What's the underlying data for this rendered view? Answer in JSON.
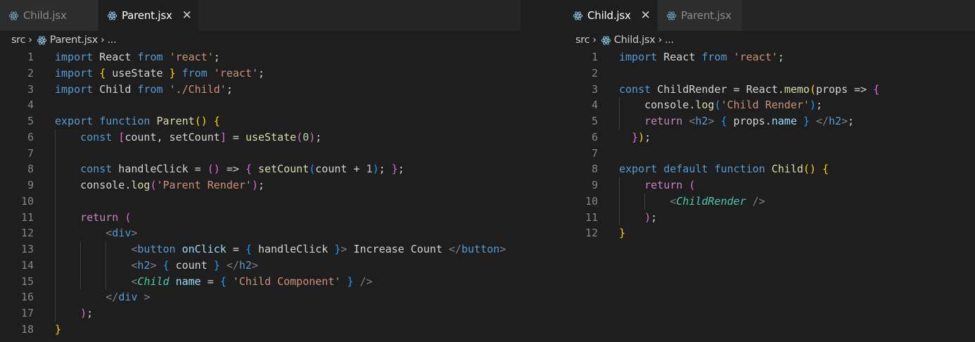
{
  "left": {
    "tabs": [
      {
        "label": "Child.jsx",
        "active": false
      },
      {
        "label": "Parent.jsx",
        "active": true,
        "close": "✕"
      }
    ],
    "breadcrumb": {
      "root": "src",
      "file": "Parent.jsx",
      "tail": "..."
    },
    "lines": [
      [
        [
          "kw",
          "import"
        ],
        [
          "plain",
          " React "
        ],
        [
          "kw",
          "from"
        ],
        [
          "plain",
          " "
        ],
        [
          "str",
          "'react'"
        ],
        [
          "plain",
          ";"
        ]
      ],
      [
        [
          "kw",
          "import"
        ],
        [
          "plain",
          " "
        ],
        [
          "b1",
          "{"
        ],
        [
          "plain",
          " useState "
        ],
        [
          "b1",
          "}"
        ],
        [
          "plain",
          " "
        ],
        [
          "kw",
          "from"
        ],
        [
          "plain",
          " "
        ],
        [
          "str",
          "'react'"
        ],
        [
          "plain",
          ";"
        ]
      ],
      [
        [
          "kw",
          "import"
        ],
        [
          "plain",
          " Child "
        ],
        [
          "kw",
          "from"
        ],
        [
          "plain",
          " "
        ],
        [
          "str",
          "'./Child'"
        ],
        [
          "plain",
          ";"
        ]
      ],
      [],
      [
        [
          "kw",
          "export"
        ],
        [
          "plain",
          " "
        ],
        [
          "kw",
          "function"
        ],
        [
          "plain",
          " "
        ],
        [
          "fn",
          "Parent"
        ],
        [
          "b1",
          "()"
        ],
        [
          "plain",
          " "
        ],
        [
          "b1",
          "{"
        ]
      ],
      [
        [
          "plain",
          "    "
        ],
        [
          "kw",
          "const"
        ],
        [
          "plain",
          " "
        ],
        [
          "b2",
          "["
        ],
        [
          "plain",
          "count, setCount"
        ],
        [
          "b2",
          "]"
        ],
        [
          "plain",
          " = "
        ],
        [
          "fn",
          "useState"
        ],
        [
          "b2",
          "("
        ],
        [
          "num",
          "0"
        ],
        [
          "b2",
          ")"
        ],
        [
          "plain",
          ";"
        ]
      ],
      [],
      [
        [
          "plain",
          "    "
        ],
        [
          "kw",
          "const"
        ],
        [
          "plain",
          " handleClick = "
        ],
        [
          "b2",
          "()"
        ],
        [
          "plain",
          " => "
        ],
        [
          "b2",
          "{"
        ],
        [
          "plain",
          " "
        ],
        [
          "fn",
          "setCount"
        ],
        [
          "b3",
          "("
        ],
        [
          "plain",
          "count + "
        ],
        [
          "num",
          "1"
        ],
        [
          "b3",
          ")"
        ],
        [
          "plain",
          "; "
        ],
        [
          "b2",
          "}"
        ],
        [
          "plain",
          ";"
        ]
      ],
      [
        [
          "plain",
          "    console."
        ],
        [
          "fn",
          "log"
        ],
        [
          "b2",
          "("
        ],
        [
          "str",
          "'Parent Render'"
        ],
        [
          "b2",
          ")"
        ],
        [
          "plain",
          ";"
        ]
      ],
      [],
      [
        [
          "plain",
          "    "
        ],
        [
          "ctl",
          "return"
        ],
        [
          "plain",
          " "
        ],
        [
          "b2",
          "("
        ]
      ],
      [
        [
          "plain",
          "        "
        ],
        [
          "punc",
          "<"
        ],
        [
          "tag",
          "div"
        ],
        [
          "punc",
          ">"
        ]
      ],
      [
        [
          "plain",
          "            "
        ],
        [
          "punc",
          "<"
        ],
        [
          "tag",
          "button"
        ],
        [
          "plain",
          " "
        ],
        [
          "attr",
          "onClick"
        ],
        [
          "plain",
          " = "
        ],
        [
          "b3",
          "{"
        ],
        [
          "plain",
          " handleClick "
        ],
        [
          "b3",
          "}"
        ],
        [
          "punc",
          ">"
        ],
        [
          "plain",
          " Increase Count "
        ],
        [
          "punc",
          "</"
        ],
        [
          "tag",
          "button"
        ],
        [
          "punc",
          ">"
        ]
      ],
      [
        [
          "plain",
          "            "
        ],
        [
          "punc",
          "<"
        ],
        [
          "tag",
          "h2"
        ],
        [
          "punc",
          ">"
        ],
        [
          "plain",
          " "
        ],
        [
          "b3",
          "{"
        ],
        [
          "plain",
          " count "
        ],
        [
          "b3",
          "}"
        ],
        [
          "plain",
          " "
        ],
        [
          "punc",
          "</"
        ],
        [
          "tag",
          "h2"
        ],
        [
          "punc",
          ">"
        ]
      ],
      [
        [
          "plain",
          "            "
        ],
        [
          "punc",
          "<"
        ],
        [
          "jsx",
          "Child"
        ],
        [
          "plain",
          " "
        ],
        [
          "attr",
          "name"
        ],
        [
          "plain",
          " = "
        ],
        [
          "b3",
          "{"
        ],
        [
          "plain",
          " "
        ],
        [
          "str",
          "'Child Component'"
        ],
        [
          "plain",
          " "
        ],
        [
          "b3",
          "}"
        ],
        [
          "plain",
          " "
        ],
        [
          "punc",
          "/>"
        ]
      ],
      [
        [
          "plain",
          "        "
        ],
        [
          "punc",
          "</"
        ],
        [
          "tag",
          "div"
        ],
        [
          "plain",
          " "
        ],
        [
          "punc",
          ">"
        ]
      ],
      [
        [
          "plain",
          "    "
        ],
        [
          "b2",
          ")"
        ],
        [
          "plain",
          ";"
        ]
      ],
      [
        [
          "b1",
          "}"
        ]
      ]
    ]
  },
  "right": {
    "tabs": [
      {
        "label": "Child.jsx",
        "active": true,
        "close": "✕"
      },
      {
        "label": "Parent.jsx",
        "active": false
      }
    ],
    "breadcrumb": {
      "root": "src",
      "file": "Child.jsx",
      "tail": "..."
    },
    "lines": [
      [
        [
          "kw",
          "import"
        ],
        [
          "plain",
          " React "
        ],
        [
          "kw",
          "from"
        ],
        [
          "plain",
          " "
        ],
        [
          "str",
          "'react'"
        ],
        [
          "plain",
          ";"
        ]
      ],
      [],
      [
        [
          "kw",
          "const"
        ],
        [
          "plain",
          " ChildRender = React."
        ],
        [
          "fn",
          "memo"
        ],
        [
          "b1",
          "("
        ],
        [
          "plain",
          "props => "
        ],
        [
          "b2",
          "{"
        ]
      ],
      [
        [
          "plain",
          "    console."
        ],
        [
          "fn",
          "log"
        ],
        [
          "b3",
          "("
        ],
        [
          "str",
          "'Child Render'"
        ],
        [
          "b3",
          ")"
        ],
        [
          "plain",
          ";"
        ]
      ],
      [
        [
          "plain",
          "    "
        ],
        [
          "ctl",
          "return"
        ],
        [
          "plain",
          " "
        ],
        [
          "punc",
          "<"
        ],
        [
          "tag",
          "h2"
        ],
        [
          "punc",
          ">"
        ],
        [
          "plain",
          " "
        ],
        [
          "b3",
          "{"
        ],
        [
          "plain",
          " props."
        ],
        [
          "var",
          "name"
        ],
        [
          "plain",
          " "
        ],
        [
          "b3",
          "}"
        ],
        [
          "plain",
          " "
        ],
        [
          "punc",
          "</"
        ],
        [
          "tag",
          "h2"
        ],
        [
          "punc",
          ">"
        ],
        [
          "plain",
          ";"
        ]
      ],
      [
        [
          "plain",
          "  "
        ],
        [
          "b2",
          "}"
        ],
        [
          "b1",
          ")"
        ],
        [
          "plain",
          ";"
        ]
      ],
      [],
      [
        [
          "kw",
          "export"
        ],
        [
          "plain",
          " "
        ],
        [
          "kw",
          "default"
        ],
        [
          "plain",
          " "
        ],
        [
          "kw",
          "function"
        ],
        [
          "plain",
          " "
        ],
        [
          "fn",
          "Child"
        ],
        [
          "b1",
          "()"
        ],
        [
          "plain",
          " "
        ],
        [
          "b1",
          "{"
        ]
      ],
      [
        [
          "plain",
          "    "
        ],
        [
          "ctl",
          "return"
        ],
        [
          "plain",
          " "
        ],
        [
          "b2",
          "("
        ]
      ],
      [
        [
          "plain",
          "        "
        ],
        [
          "punc",
          "<"
        ],
        [
          "jsx",
          "ChildRender"
        ],
        [
          "plain",
          " "
        ],
        [
          "punc",
          "/>"
        ]
      ],
      [
        [
          "plain",
          "    "
        ],
        [
          "b2",
          ")"
        ],
        [
          "plain",
          ";"
        ]
      ],
      [
        [
          "b1",
          "}"
        ]
      ]
    ]
  }
}
